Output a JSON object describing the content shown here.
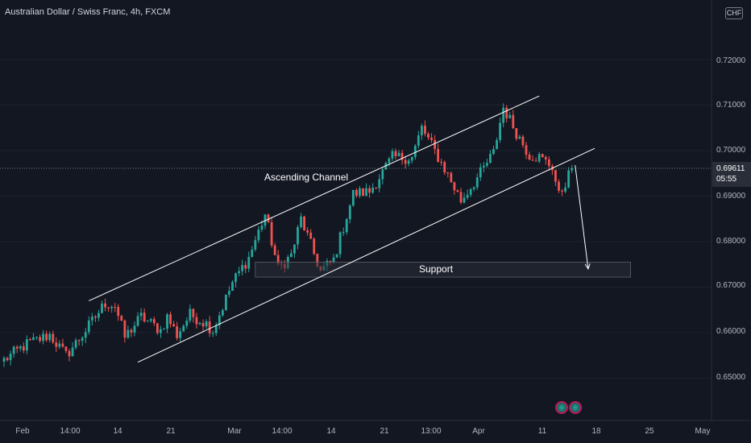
{
  "header": {
    "title": "Australian Dollar / Swiss Franc, 4h, FXCM",
    "currency": "CHF"
  },
  "price_label": {
    "price": "0.69611",
    "countdown": "05:55"
  },
  "annotations": {
    "channel": "Ascending Channel",
    "support": "Support"
  },
  "colors": {
    "background": "#131722",
    "up": "#26a69a",
    "down": "#ef5350",
    "drawing": "#ffffff",
    "grid": "#1e222d",
    "support_zone": "#2a2e39"
  },
  "chart_data": {
    "type": "candlestick",
    "title": "Australian Dollar / Swiss Franc, 4h, FXCM",
    "ylim": [
      0.643,
      0.7245
    ],
    "grid": true,
    "y_ticks": [
      "0.72000",
      "0.71000",
      "0.70000",
      "0.69000",
      "0.68000",
      "0.67000",
      "0.66000",
      "0.65000"
    ],
    "x_ticks": [
      "Feb",
      "14:00",
      "14",
      "21",
      "Mar",
      "14:00",
      "14",
      "21",
      "13:00",
      "Apr",
      "11",
      "18",
      "25",
      "May"
    ],
    "close_path": [
      [
        0,
        0.654
      ],
      [
        7,
        0.6575
      ],
      [
        14,
        0.6595
      ],
      [
        19,
        0.655
      ],
      [
        24,
        0.6595
      ],
      [
        31,
        0.6665
      ],
      [
        34,
        0.666
      ],
      [
        37,
        0.659
      ],
      [
        42,
        0.6635
      ],
      [
        48,
        0.6605
      ],
      [
        50,
        0.6635
      ],
      [
        53,
        0.6595
      ],
      [
        57,
        0.664
      ],
      [
        62,
        0.662
      ],
      [
        64,
        0.6605
      ],
      [
        70,
        0.671
      ],
      [
        75,
        0.6765
      ],
      [
        80,
        0.686
      ],
      [
        84,
        0.674
      ],
      [
        88,
        0.677
      ],
      [
        91,
        0.685
      ],
      [
        97,
        0.6735
      ],
      [
        101,
        0.676
      ],
      [
        107,
        0.6905
      ],
      [
        112,
        0.691
      ],
      [
        119,
        0.6985
      ],
      [
        125,
        0.6985
      ],
      [
        128,
        0.705
      ],
      [
        135,
        0.696
      ],
      [
        140,
        0.689
      ],
      [
        146,
        0.695
      ],
      [
        150,
        0.6995
      ],
      [
        153,
        0.7095
      ],
      [
        157,
        0.704
      ],
      [
        161,
        0.699
      ],
      [
        164,
        0.6985
      ],
      [
        168,
        0.6965
      ],
      [
        170,
        0.69
      ],
      [
        174,
        0.6961
      ]
    ],
    "channel": {
      "upper": [
        [
          26,
          0.667
        ],
        [
          164,
          0.712
        ]
      ],
      "lower": [
        [
          41,
          0.6535
        ],
        [
          181,
          0.7005
        ]
      ]
    },
    "support_zone": {
      "y": [
        0.6722,
        0.6755
      ],
      "x": [
        77,
        192
      ]
    },
    "current_price": 0.69611,
    "projection": [
      [
        175,
        0.6968
      ],
      [
        179,
        0.674
      ]
    ]
  }
}
